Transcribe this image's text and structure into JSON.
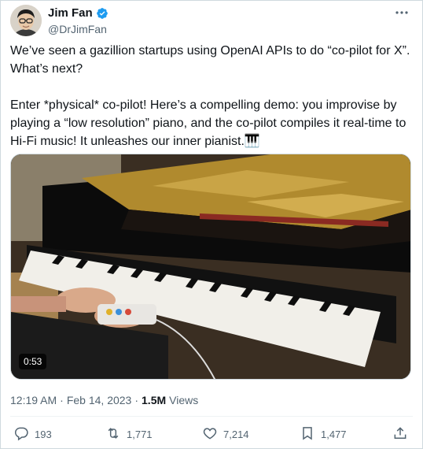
{
  "author": {
    "display_name": "Jim Fan",
    "handle": "@DrJimFan",
    "verified": true
  },
  "tweet": {
    "paragraph_1_line_1": "We’ve seen a gazillion startups using OpenAI APIs to do “co-pilot for X”.",
    "paragraph_1_line_2": "What’s next?",
    "paragraph_2_line_1": "Enter *physical* co-pilot! Here’s a compelling demo: you improvise by",
    "paragraph_2_line_2": "playing a “low resolution” piano, and the co-pilot compiles it real-time to",
    "paragraph_2_line_3": "Hi-Fi music! It unleashes our inner pianist.🎹"
  },
  "media": {
    "type": "video",
    "duration": "0:53"
  },
  "meta": {
    "time": "12:19 AM",
    "separator_1": "·",
    "date": "Feb 14, 2023",
    "separator_2": "·",
    "views_count": "1.5M",
    "views_label": "Views"
  },
  "actions": {
    "replies": "193",
    "retweets": "1,771",
    "likes": "7,214",
    "bookmarks": "1,477"
  },
  "colors": {
    "verified": "#1d9bf0",
    "secondary_text": "#536471",
    "border": "#cfd9de"
  },
  "icons": [
    "verified-badge-icon",
    "more-icon",
    "reply-icon",
    "retweet-icon",
    "like-icon",
    "bookmark-icon",
    "share-icon"
  ]
}
